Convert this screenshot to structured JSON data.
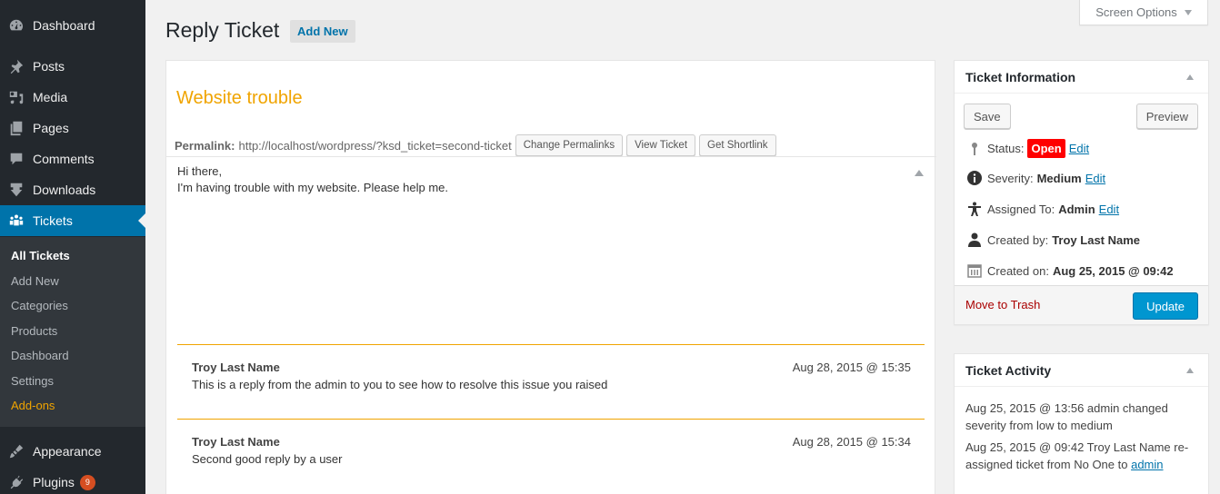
{
  "sidebar": {
    "items": [
      {
        "label": "Dashboard",
        "icon": "dashboard-icon"
      },
      {
        "label": "Posts",
        "icon": "pin-icon"
      },
      {
        "label": "Media",
        "icon": "media-icon"
      },
      {
        "label": "Pages",
        "icon": "pages-icon"
      },
      {
        "label": "Comments",
        "icon": "comment-icon"
      },
      {
        "label": "Downloads",
        "icon": "download-icon"
      },
      {
        "label": "Tickets",
        "icon": "groups-icon"
      },
      {
        "label": "Appearance",
        "icon": "brush-icon"
      },
      {
        "label": "Plugins",
        "icon": "plugin-icon",
        "badge": "9"
      }
    ],
    "submenu": [
      "All Tickets",
      "Add New",
      "Categories",
      "Products",
      "Dashboard",
      "Settings",
      "Add-ons"
    ]
  },
  "header": {
    "title": "Reply Ticket",
    "add_new": "Add New",
    "screen_options": "Screen Options"
  },
  "ticket": {
    "title": "Website trouble",
    "permalink_label": "Permalink:",
    "permalink_url": "http://localhost/wordpress/?ksd_ticket=second-ticket",
    "buttons": [
      "Change Permalinks",
      "View Ticket",
      "Get Shortlink"
    ],
    "body_lines": [
      "Hi there,",
      "I'm having trouble with my website. Please help me."
    ],
    "replies": [
      {
        "author": "Troy Last Name",
        "date": "Aug 28, 2015 @ 15:35",
        "body": "This is a reply from the admin to you to see how to resolve this issue you raised"
      },
      {
        "author": "Troy Last Name",
        "date": "Aug 28, 2015 @ 15:34",
        "body": "Second good reply by a user"
      }
    ]
  },
  "ticket_info": {
    "heading": "Ticket Information",
    "save": "Save",
    "preview": "Preview",
    "status_label": "Status:",
    "status_value": "Open",
    "severity_label": "Severity:",
    "severity_value": "Medium",
    "assigned_label": "Assigned To:",
    "assigned_value": "Admin",
    "created_by_label": "Created by:",
    "created_by_value": "Troy Last Name",
    "created_on_label": "Created on:",
    "created_on_value": "Aug 25, 2015 @ 09:42",
    "edit": "Edit",
    "trash": "Move to Trash",
    "update": "Update",
    "colors": {
      "status_open": "#ff0000",
      "update_button": "#0096d0"
    }
  },
  "ticket_activity": {
    "heading": "Ticket Activity",
    "items": [
      {
        "text": "Aug 25, 2015 @ 13:56 admin changed severity from low to medium"
      },
      {
        "text": "Aug 25, 2015 @ 09:42 Troy Last Name re-assigned ticket from No One to ",
        "link": "admin"
      }
    ]
  }
}
